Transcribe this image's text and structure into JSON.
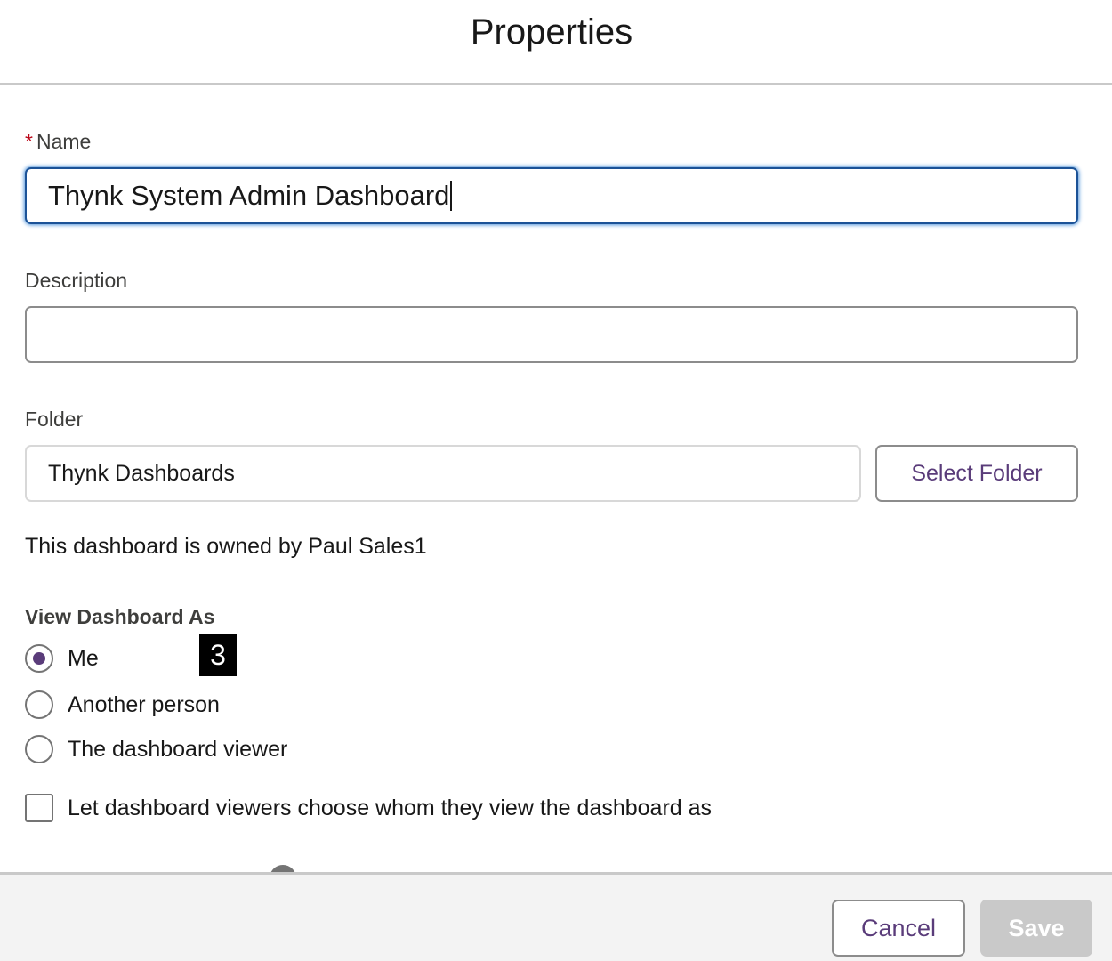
{
  "header": {
    "title": "Properties"
  },
  "form": {
    "name_label": "Name",
    "required_marker": "*",
    "name_value": "Thynk System Admin Dashboard",
    "description_label": "Description",
    "description_value": "",
    "folder_label": "Folder",
    "folder_value": "Thynk Dashboards",
    "select_folder_label": "Select Folder",
    "owner_text": "This dashboard is owned by Paul Sales1"
  },
  "view_as": {
    "title": "View Dashboard As",
    "options": [
      {
        "label": "Me",
        "checked": true
      },
      {
        "label": "Another person",
        "checked": false
      },
      {
        "label": "The dashboard viewer",
        "checked": false
      }
    ],
    "let_viewers_choose_label": "Let dashboard viewers choose whom they view the dashboard as",
    "let_viewers_choose_checked": false
  },
  "annotation": {
    "badge": "3"
  },
  "footer": {
    "cancel_label": "Cancel",
    "save_label": "Save"
  },
  "colors": {
    "accent": "#5a3c7a",
    "focus_border": "#1b5297",
    "required": "#ba0517",
    "disabled_button": "#c9c9c9"
  }
}
